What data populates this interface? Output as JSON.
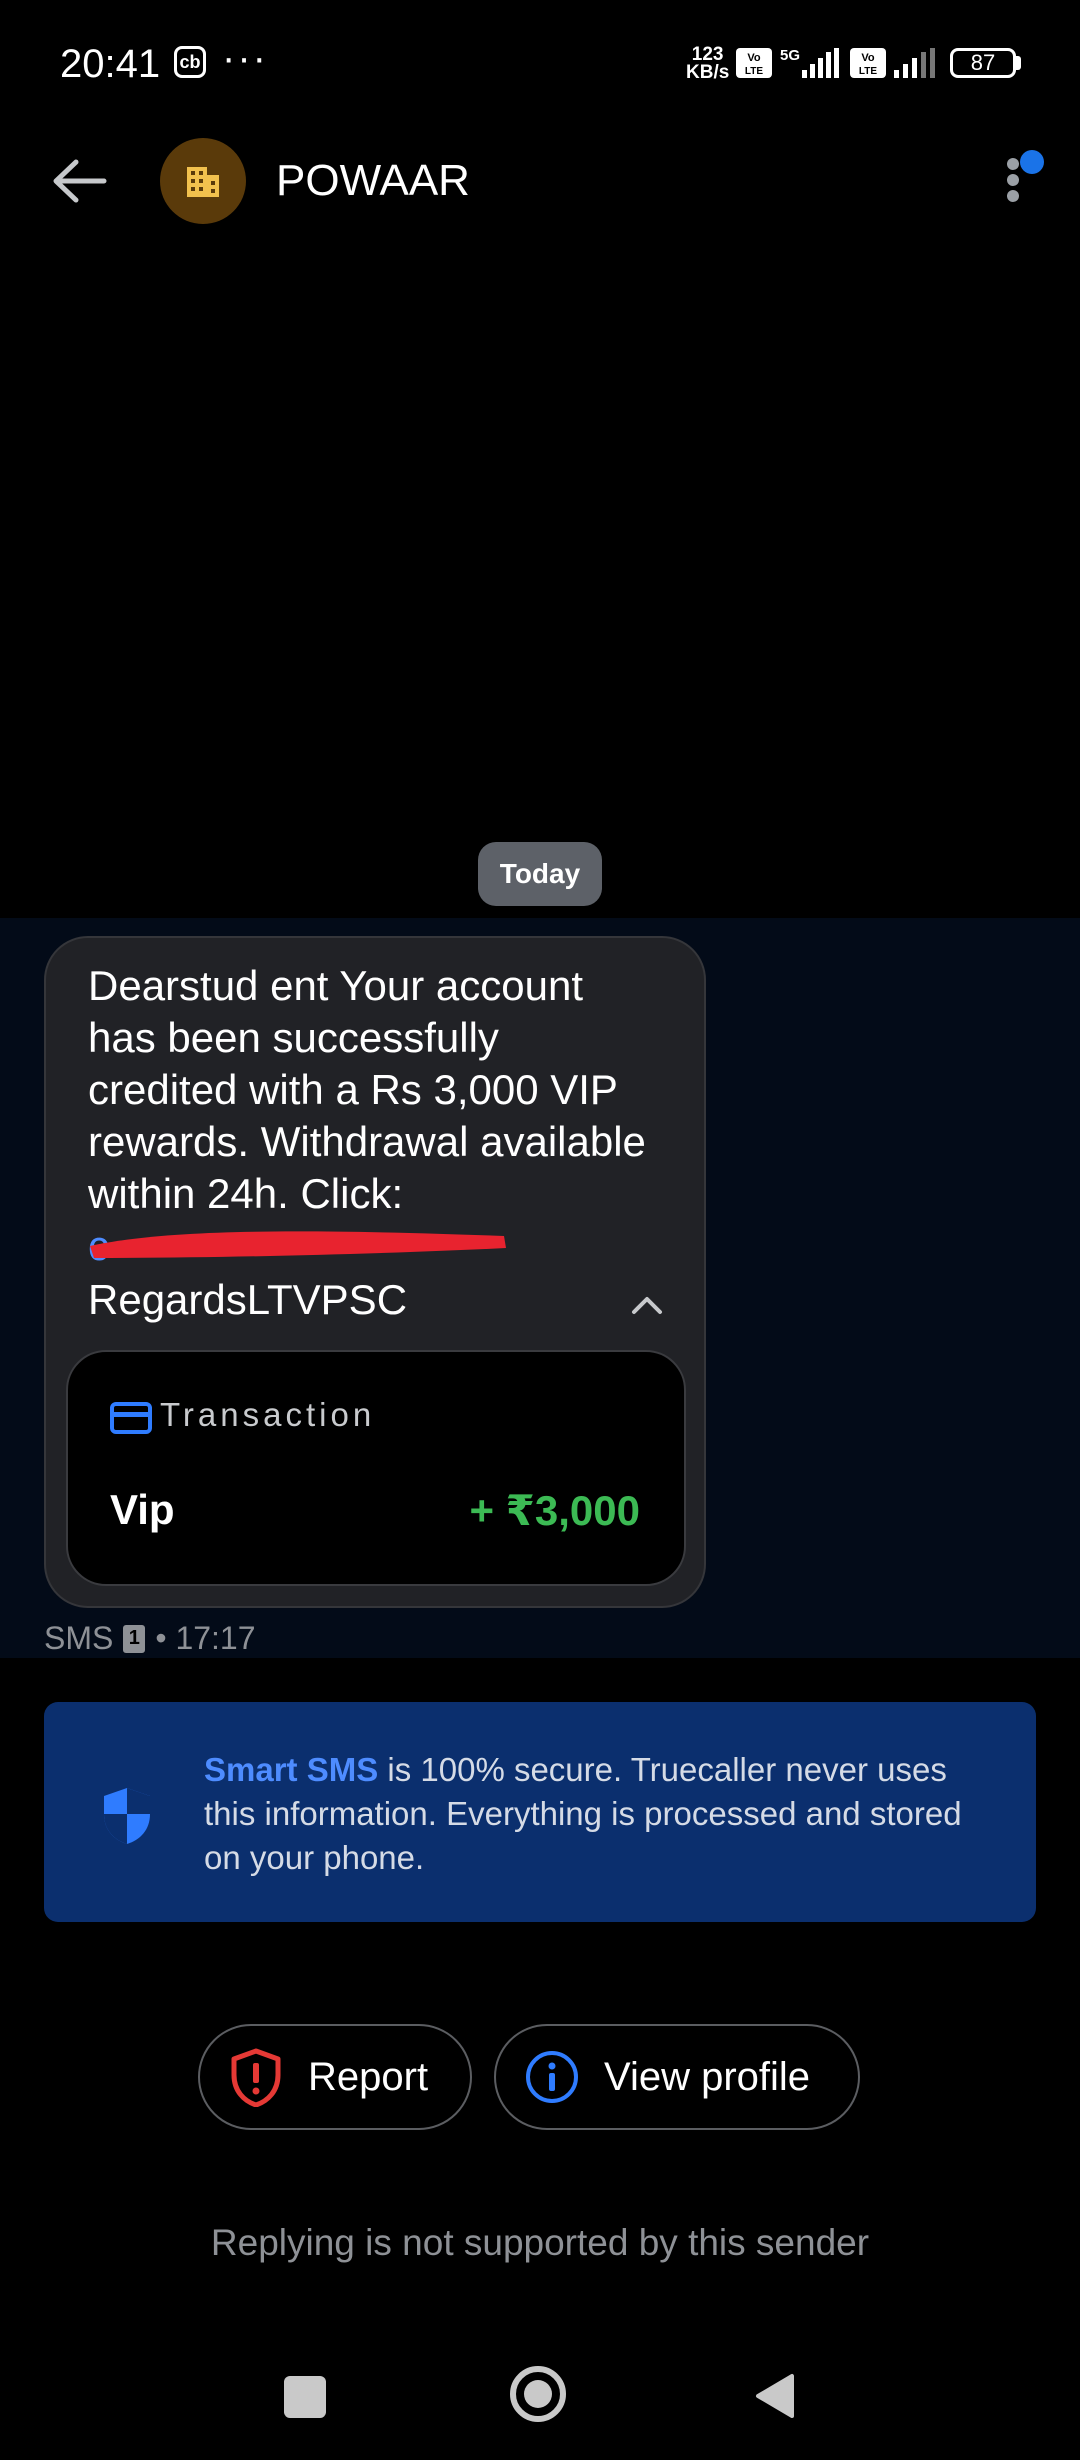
{
  "status_bar": {
    "time": "20:41",
    "cb_label": "cb",
    "more": "···",
    "net_speed_value": "123",
    "net_speed_unit": "KB/s",
    "volte_1": "Vo LTE",
    "network_5g": "5G",
    "volte_2": "Vo LTE",
    "battery": "87"
  },
  "header": {
    "sender_name": "POWAAR",
    "avatar_icon": "building-icon"
  },
  "conversation": {
    "date_chip": "Today",
    "message": {
      "body": "Dearstud ent Your account has been successfully credited with a Rs 3,000 VIP rewards. Withdrawal available within 24h. Click:",
      "link_visible": "c··· ···········",
      "signature": "RegardsLTVPSC",
      "transaction": {
        "label": "Transaction",
        "name": "Vip",
        "amount": "+ ₹3,000"
      },
      "meta_channel": "SMS",
      "meta_sim": "1",
      "meta_time": "• 17:17"
    }
  },
  "banner": {
    "accent": "Smart SMS",
    "text": " is 100% secure. Truecaller never uses this information. Everything is processed and stored on your phone."
  },
  "actions": {
    "report_label": "Report",
    "view_profile_label": "View profile"
  },
  "footer_note": "Replying is not supported by this sender",
  "colors": {
    "accent_blue": "#4e8cff",
    "amount_green": "#3cba54",
    "report_red": "#e53935",
    "banner_bg": "#0b2f6e"
  }
}
